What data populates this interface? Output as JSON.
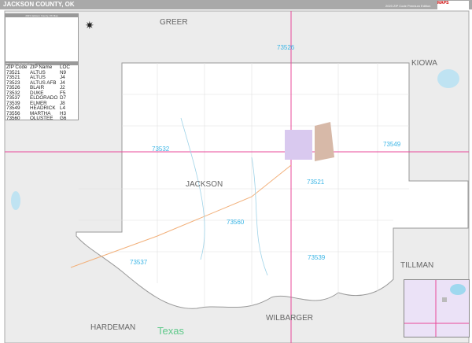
{
  "title": "JACKSON COUNTY, OK",
  "edition": "2023 ZIP Code Premium Edition",
  "logo_text": "MARKET MAPS",
  "legend_title": "2023 Jackson County, OK Map",
  "neighbors": [
    "GREER",
    "KIOWA",
    "TILLMAN",
    "WILBARGER",
    "HARDEMAN"
  ],
  "county_label": "JACKSON",
  "state_label": "Texas",
  "zip_labels": [
    "73526",
    "73532",
    "73549",
    "73521",
    "73560",
    "73537",
    "73539"
  ],
  "zip_index": {
    "header": "ZIP Code Index/Grid Locator",
    "columns": [
      "ZIP Code",
      "ZIP Name",
      "LOC"
    ],
    "rows": [
      [
        "73521",
        "ALTUS",
        "N9"
      ],
      [
        "73521",
        "ALTUS",
        "J4"
      ],
      [
        "73523",
        "ALTUS AFB",
        "J4"
      ],
      [
        "73526",
        "BLAIR",
        "J2"
      ],
      [
        "73532",
        "DUKE",
        "F5"
      ],
      [
        "73537",
        "ELDORADO",
        "D7"
      ],
      [
        "73539",
        "ELMER",
        "J8"
      ],
      [
        "73549",
        "HEADRICK",
        "L4"
      ],
      [
        "73556",
        "MARTHA",
        "H3"
      ],
      [
        "73560",
        "OLUSTEE",
        "G6"
      ]
    ]
  },
  "colors": {
    "zip_label": "#3ab5e6",
    "highway": "#e8489a",
    "outside": "#ececec",
    "city": "#d9c9ef"
  }
}
